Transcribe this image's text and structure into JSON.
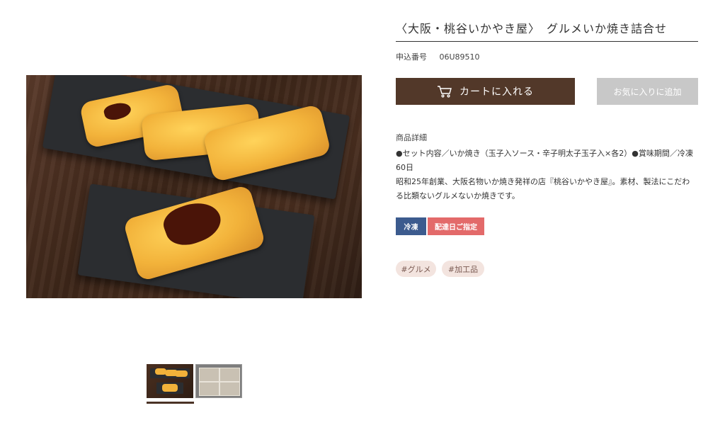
{
  "product": {
    "title": "〈大阪・桃谷いかやき屋〉　グルメいか焼き詰合せ",
    "order_label": "申込番号",
    "order_number": "06U89510"
  },
  "buttons": {
    "cart": "カートに入れる",
    "cart_icon": "cart-icon",
    "favorite": "お気に入りに追加"
  },
  "details": {
    "heading": "商品詳細",
    "line1": "●セット内容／いか焼き（玉子入ソース・辛子明太子玉子入×各2）●賞味期間／冷凍60日",
    "line2": "昭和25年創業、大阪名物いか焼き発祥の店『桃谷いかやき屋』。素材、製法にこだわる比類ないグルメないか焼きです。"
  },
  "badges": {
    "frozen": "冷凍",
    "date": "配達日ご指定"
  },
  "tags": [
    "#グルメ",
    "#加工品"
  ],
  "colors": {
    "cart_button": "#523829",
    "favorite_button": "#c8c8c8",
    "frozen_badge": "#3c5b8e",
    "date_badge": "#e36a6a",
    "tag_bg": "#f3e4df"
  },
  "gallery": {
    "selected_index": 0,
    "thumbnails": [
      "thumbnail-ikayaki",
      "thumbnail-package"
    ]
  }
}
